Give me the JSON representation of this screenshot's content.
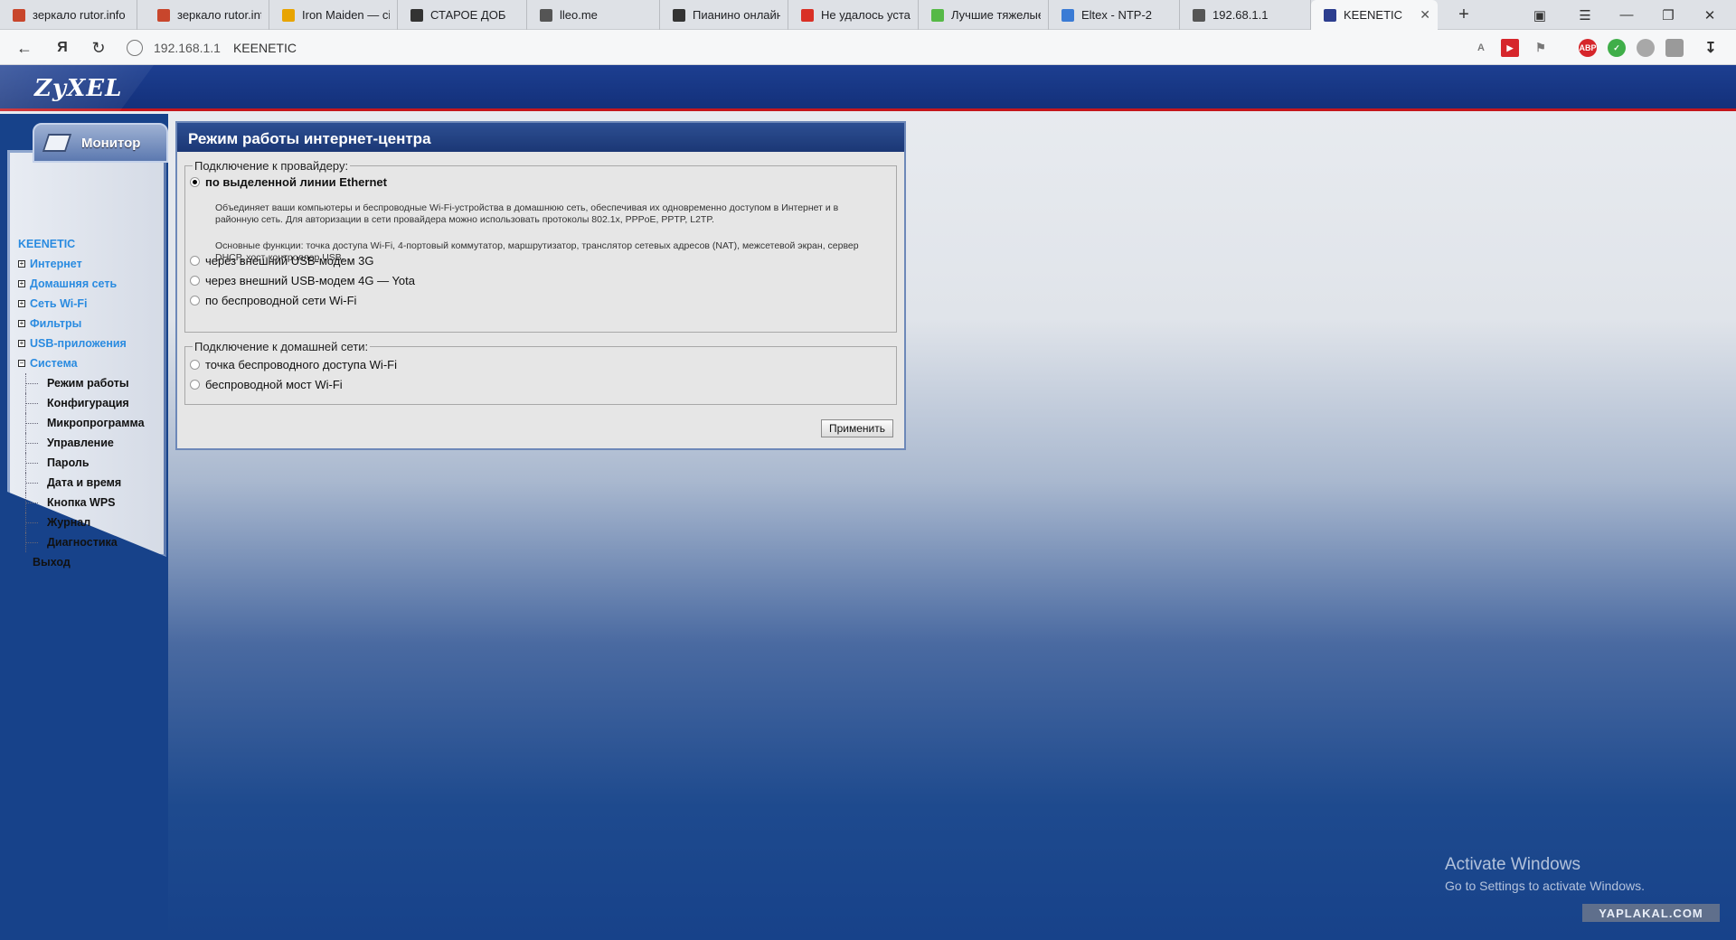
{
  "browser": {
    "tabs": [
      {
        "title": "зеркало rutor.info",
        "icon": "rutor-icon",
        "color": "#c8462c"
      },
      {
        "title": "зеркало rutor.info",
        "icon": "rutor-icon",
        "color": "#c8462c"
      },
      {
        "title": "Iron Maiden — ci",
        "icon": "music-icon",
        "color": "#e8a400"
      },
      {
        "title": "СТАРОЕ ДОБ",
        "icon": "play-icon",
        "color": "#333333"
      },
      {
        "title": "lleo.me",
        "icon": "page-icon",
        "color": "#555555"
      },
      {
        "title": "Пианино онлайн",
        "icon": "piano-icon",
        "color": "#333333"
      },
      {
        "title": "Не удалось устан",
        "icon": "mail-icon",
        "color": "#d93025"
      },
      {
        "title": "Лучшие тяжелые",
        "icon": "f-icon",
        "color": "#56b947"
      },
      {
        "title": "Eltex - NTP-2",
        "icon": "eltex-icon",
        "color": "#3a7bd5"
      },
      {
        "title": "192.68.1.1",
        "icon": "page-icon",
        "color": "#555555"
      },
      {
        "title": "KEENETIC",
        "icon": "zyxel-icon",
        "color": "#2c3e8f",
        "active": true
      }
    ],
    "new_tab": "+",
    "address": {
      "host": "192.168.1.1",
      "title": "KEENETIC"
    },
    "yandex_label": "Я"
  },
  "router": {
    "logo": "ZyXEL",
    "monitor_label": "Монитор",
    "menu": {
      "brand": "KEENETIC",
      "groups": [
        {
          "label": "Интернет",
          "expanded": false
        },
        {
          "label": "Домашняя сеть",
          "expanded": false
        },
        {
          "label": "Сеть Wi-Fi",
          "expanded": false
        },
        {
          "label": "Фильтры",
          "expanded": false
        },
        {
          "label": "USB-приложения",
          "expanded": false
        },
        {
          "label": "Система",
          "expanded": true
        }
      ],
      "system_items": [
        "Режим работы",
        "Конфигурация",
        "Микропрограмма",
        "Управление",
        "Пароль",
        "Дата и время",
        "Кнопка WPS",
        "Журнал",
        "Диагностика"
      ],
      "exit": "Выход"
    },
    "content": {
      "title": "Режим работы интернет-центра",
      "provider_legend": "Подключение к провайдеру:",
      "provider_options": [
        "по выделенной линии Ethernet",
        "через внешний USB-модем 3G",
        "через внешний USB-модем 4G — Yota",
        "по беспроводной сети Wi-Fi"
      ],
      "selected_provider": 0,
      "desc1": "Объединяет ваши компьютеры и беспроводные Wi-Fi-устройства в домашнюю сеть, обеспечивая их одновременно доступом в Интернет и в районную сеть. Для авторизации в сети провайдера можно использовать протоколы 802.1x, PPPoE, PPTP, L2TP.",
      "desc2": "Основные функции: точка доступа Wi-Fi, 4-портовый коммутатор, маршрутизатор, транслятор сетевых адресов (NAT), межсетевой экран, сервер DHCP, хост-контроллер USB.",
      "home_legend": "Подключение к домашней сети:",
      "home_options": [
        "точка беспроводного доступа Wi-Fi",
        "беспроводной мост Wi-Fi"
      ],
      "apply_label": "Применить"
    }
  },
  "overlay": {
    "activate_title": "Activate Windows",
    "activate_sub": "Go to Settings to activate Windows.",
    "watermark": "YAPLAKAL.COM"
  }
}
